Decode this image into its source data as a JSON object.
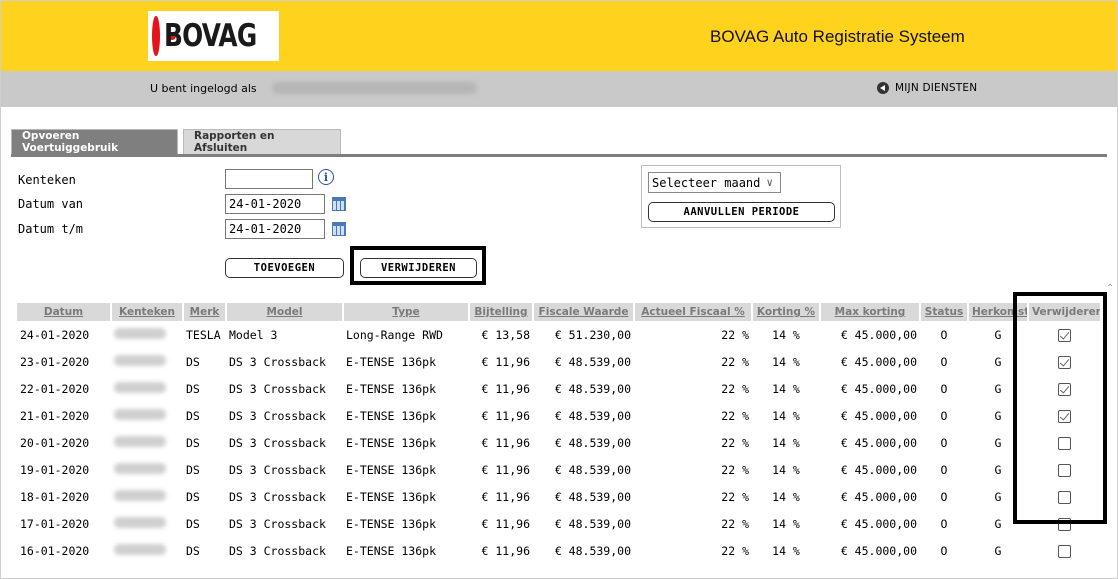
{
  "header": {
    "logo_text": "BOVAG",
    "app_title": "BOVAG Auto Registratie Systeem"
  },
  "userbar": {
    "logged_in_label": "U bent ingelogd als",
    "services_label": "MIJN DIENSTEN"
  },
  "tabs": [
    {
      "label": "Opvoeren Voertuiggebruik",
      "active": true
    },
    {
      "label": "Rapporten en Afsluiten",
      "active": false
    }
  ],
  "form": {
    "kenteken_label": "Kenteken",
    "kenteken_value": "",
    "datum_van_label": "Datum van",
    "datum_van_value": "24-01-2020",
    "datum_tm_label": "Datum t/m",
    "datum_tm_value": "24-01-2020",
    "add_button": "TOEVOEGEN",
    "remove_button": "VERWIJDEREN",
    "month_select": "Selecteer maand",
    "fill_period_button": "AANVULLEN PERIODE"
  },
  "table": {
    "columns": [
      "Datum",
      "Kenteken",
      "Merk",
      "Model",
      "Type",
      "Bijtelling",
      "Fiscale Waarde",
      "Actueel Fiscaal %",
      "Korting %",
      "Max korting",
      "Status",
      "Herkomst",
      "Verwijderen"
    ],
    "rows": [
      {
        "datum": "24-01-2020",
        "merk": "TESLA",
        "model": "Model 3",
        "type": "Long-Range RWD",
        "bijtelling": "€ 13,58",
        "fiscale": "€ 51.230,00",
        "actueel": "22 %",
        "korting": "14 %",
        "max": "€ 45.000,00",
        "status": "O",
        "herkomst": "G",
        "checked": true
      },
      {
        "datum": "23-01-2020",
        "merk": "DS",
        "model": "DS 3 Crossback",
        "type": "E-TENSE 136pk",
        "bijtelling": "€ 11,96",
        "fiscale": "€ 48.539,00",
        "actueel": "22 %",
        "korting": "14 %",
        "max": "€ 45.000,00",
        "status": "O",
        "herkomst": "G",
        "checked": true
      },
      {
        "datum": "22-01-2020",
        "merk": "DS",
        "model": "DS 3 Crossback",
        "type": "E-TENSE 136pk",
        "bijtelling": "€ 11,96",
        "fiscale": "€ 48.539,00",
        "actueel": "22 %",
        "korting": "14 %",
        "max": "€ 45.000,00",
        "status": "O",
        "herkomst": "G",
        "checked": true
      },
      {
        "datum": "21-01-2020",
        "merk": "DS",
        "model": "DS 3 Crossback",
        "type": "E-TENSE 136pk",
        "bijtelling": "€ 11,96",
        "fiscale": "€ 48.539,00",
        "actueel": "22 %",
        "korting": "14 %",
        "max": "€ 45.000,00",
        "status": "O",
        "herkomst": "G",
        "checked": true
      },
      {
        "datum": "20-01-2020",
        "merk": "DS",
        "model": "DS 3 Crossback",
        "type": "E-TENSE 136pk",
        "bijtelling": "€ 11,96",
        "fiscale": "€ 48.539,00",
        "actueel": "22 %",
        "korting": "14 %",
        "max": "€ 45.000,00",
        "status": "O",
        "herkomst": "G",
        "checked": false
      },
      {
        "datum": "19-01-2020",
        "merk": "DS",
        "model": "DS 3 Crossback",
        "type": "E-TENSE 136pk",
        "bijtelling": "€ 11,96",
        "fiscale": "€ 48.539,00",
        "actueel": "22 %",
        "korting": "14 %",
        "max": "€ 45.000,00",
        "status": "O",
        "herkomst": "G",
        "checked": false
      },
      {
        "datum": "18-01-2020",
        "merk": "DS",
        "model": "DS 3 Crossback",
        "type": "E-TENSE 136pk",
        "bijtelling": "€ 11,96",
        "fiscale": "€ 48.539,00",
        "actueel": "22 %",
        "korting": "14 %",
        "max": "€ 45.000,00",
        "status": "O",
        "herkomst": "G",
        "checked": false
      },
      {
        "datum": "17-01-2020",
        "merk": "DS",
        "model": "DS 3 Crossback",
        "type": "E-TENSE 136pk",
        "bijtelling": "€ 11,96",
        "fiscale": "€ 48.539,00",
        "actueel": "22 %",
        "korting": "14 %",
        "max": "€ 45.000,00",
        "status": "O",
        "herkomst": "G",
        "checked": false
      },
      {
        "datum": "16-01-2020",
        "merk": "DS",
        "model": "DS 3 Crossback",
        "type": "E-TENSE 136pk",
        "bijtelling": "€ 11,96",
        "fiscale": "€ 48.539,00",
        "actueel": "22 %",
        "korting": "14 %",
        "max": "€ 45.000,00",
        "status": "O",
        "herkomst": "G",
        "checked": false
      }
    ]
  },
  "colors": {
    "header_yellow": "#ffd21d",
    "userbar_gray": "#c9c9c9",
    "tab_active": "#7f7f7f",
    "logo_red": "#e3141b"
  },
  "icons": [
    "bovag-logo-icon",
    "back-arrow-icon",
    "info-icon",
    "calendar-icon",
    "chevron-down-icon",
    "checkbox-icon",
    "scroll-up-icon"
  ]
}
